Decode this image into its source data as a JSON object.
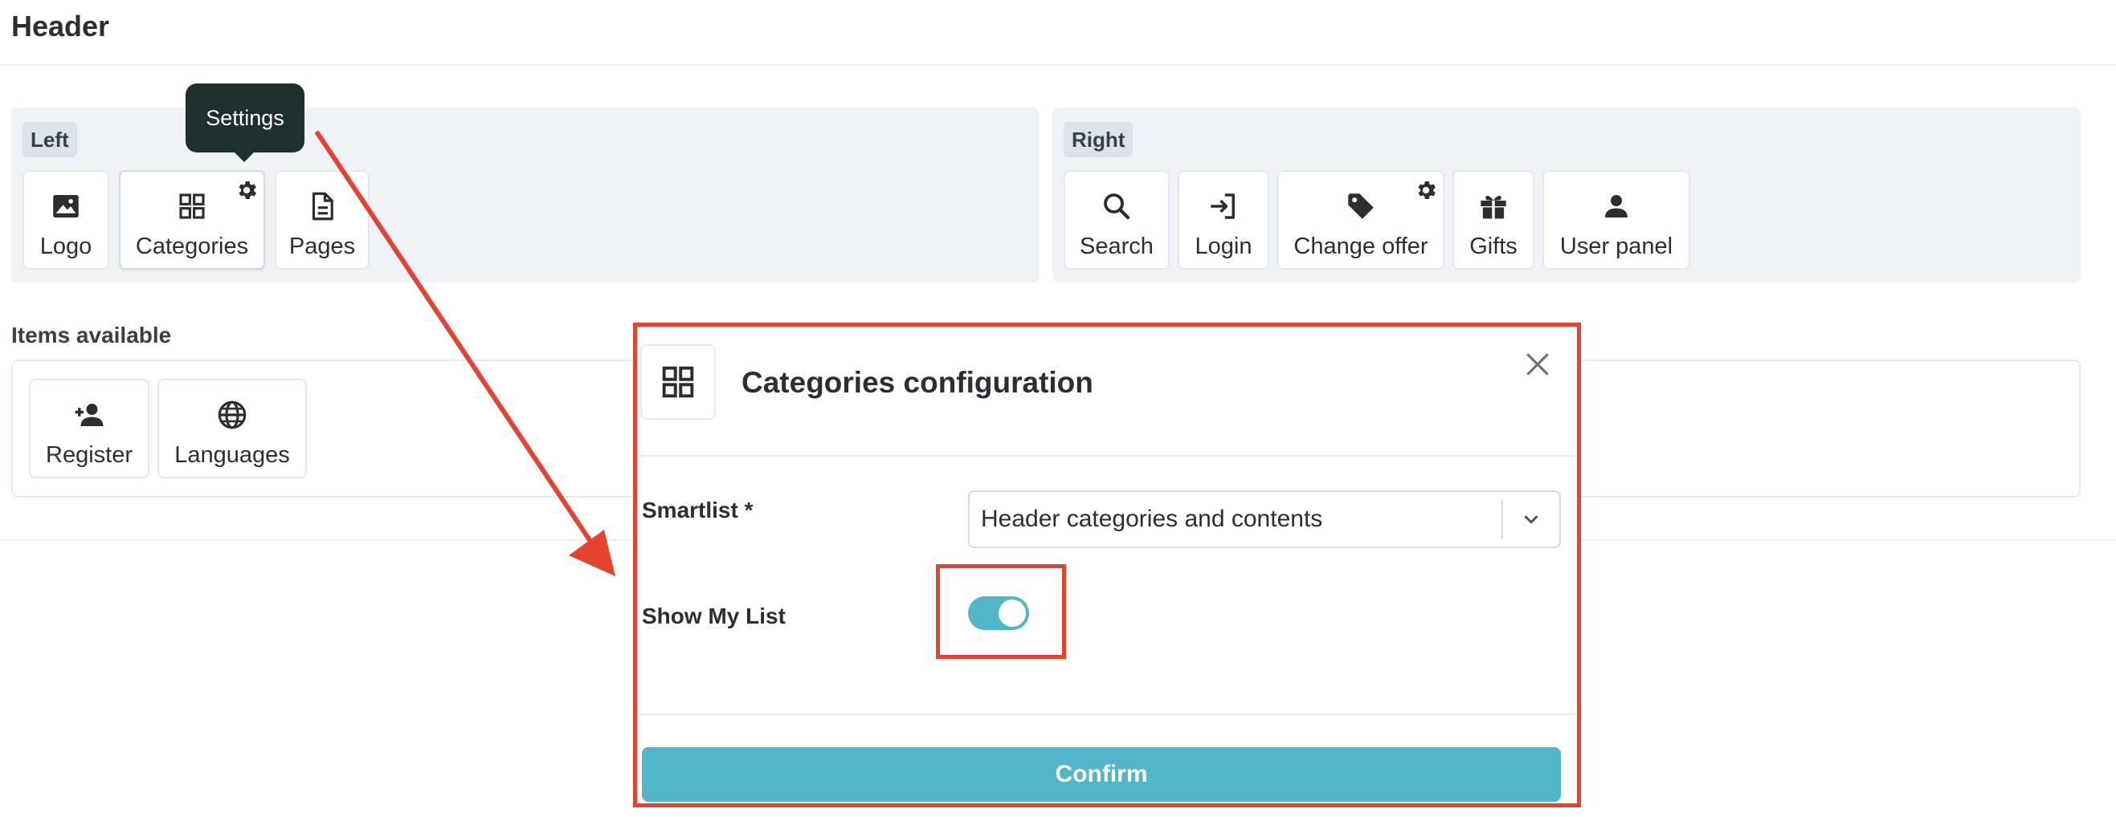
{
  "page": {
    "title": "Header"
  },
  "zones": {
    "left": {
      "label": "Left",
      "items": [
        {
          "label": "Logo",
          "icon": "image-icon"
        },
        {
          "label": "Categories",
          "icon": "grid-icon",
          "has_settings": true
        },
        {
          "label": "Pages",
          "icon": "document-icon"
        }
      ]
    },
    "right": {
      "label": "Right",
      "items": [
        {
          "label": "Search",
          "icon": "search-icon"
        },
        {
          "label": "Login",
          "icon": "login-icon"
        },
        {
          "label": "Change offer",
          "icon": "tag-icon",
          "has_settings": true
        },
        {
          "label": "Gifts",
          "icon": "gift-icon"
        },
        {
          "label": "User panel",
          "icon": "user-icon"
        }
      ]
    }
  },
  "available": {
    "title": "Items available",
    "items": [
      {
        "label": "Register",
        "icon": "user-plus-icon"
      },
      {
        "label": "Languages",
        "icon": "globe-icon"
      }
    ]
  },
  "tooltip": {
    "text": "Settings"
  },
  "modal": {
    "title": "Categories configuration",
    "smartlist_label": "Smartlist *",
    "smartlist_value": "Header categories and contents",
    "show_my_list_label": "Show My List",
    "show_my_list_enabled": true,
    "confirm_label": "Confirm"
  },
  "colors": {
    "accent": "#52b5c8",
    "annotation": "#e5432f",
    "tooltip_bg": "#1d2f2f",
    "zone_bg": "#eff2f6"
  }
}
